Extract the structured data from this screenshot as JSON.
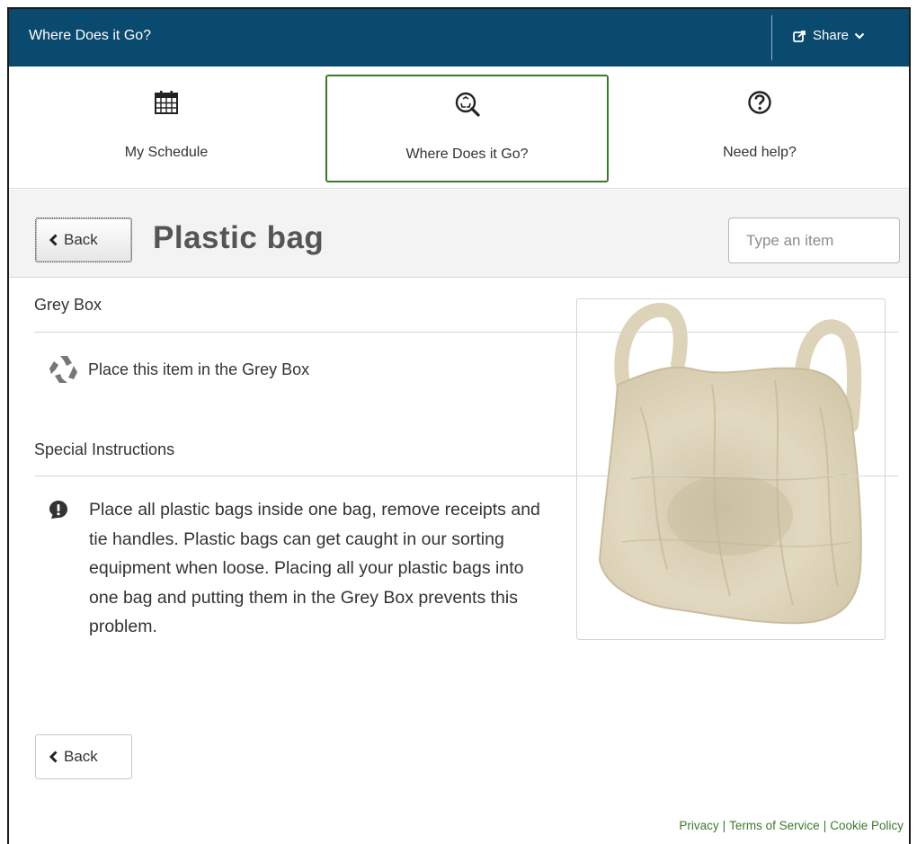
{
  "header": {
    "app_title": "Where Does it Go?",
    "share_label": "Share",
    "bar_color": "#0a4a6e"
  },
  "nav": {
    "tabs": [
      {
        "label": "My Schedule",
        "icon": "calendar-icon",
        "active": false
      },
      {
        "label": "Where Does it Go?",
        "icon": "recycle-search-icon",
        "active": true
      },
      {
        "label": "Need help?",
        "icon": "question-icon",
        "active": false
      }
    ],
    "active_color": "#3b7a2c"
  },
  "titlebar": {
    "back_label": "Back",
    "title": "Plastic bag",
    "search_placeholder": "Type an item",
    "search_value": ""
  },
  "item": {
    "category_heading": "Grey Box",
    "disposal_text": "Place this item in the Grey Box",
    "disposal_icon": "recycle-icon",
    "special_heading": "Special Instructions",
    "special_icon": "alert-icon",
    "special_text": "Place all plastic bags inside one bag, remove receipts and tie handles. Plastic bags can get caught in our sorting equipment when loose. Placing all your plastic bags into one bag and putting them in the Grey Box prevents this problem.",
    "image_subject": "plastic-bag-photo"
  },
  "bottom": {
    "back_label": "Back"
  },
  "footer": {
    "links": [
      "Privacy",
      "Terms of Service",
      "Cookie Policy"
    ],
    "separator": "|",
    "link_color": "#3b7a2c"
  }
}
